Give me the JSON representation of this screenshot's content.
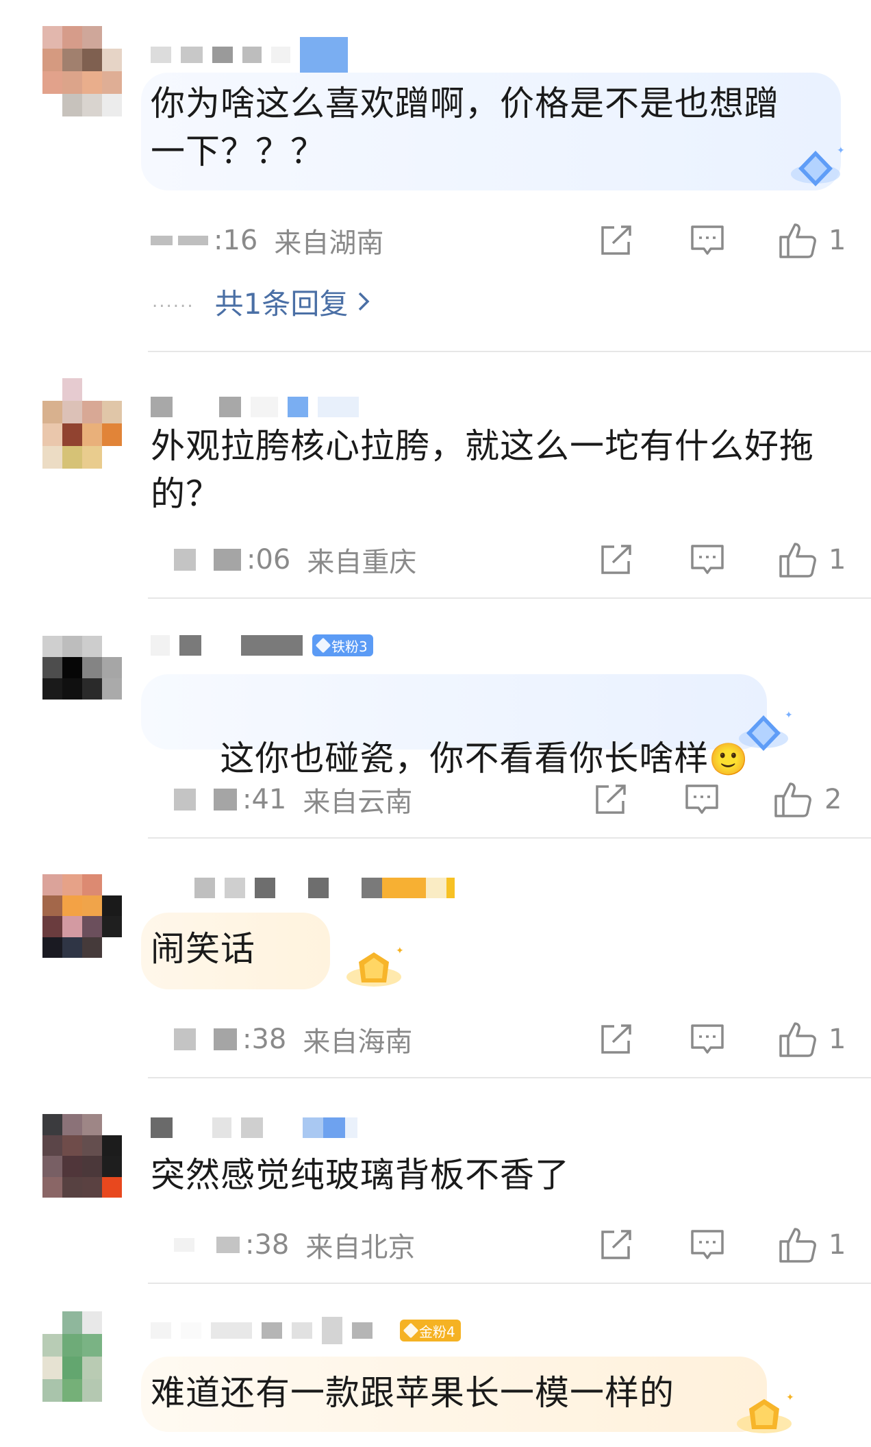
{
  "comments": [
    {
      "text": "你为啥这么喜欢蹭啊，价格是不是也想蹭一下？？？",
      "text_lines": [
        "你为啥这么喜欢蹭啊，价格是不是也想蹭",
        "一下？？？"
      ],
      "time": ":16",
      "location": "来自湖南",
      "likes": "1",
      "replies_link": "共1条回复",
      "badge": "",
      "bubble": "blue"
    },
    {
      "text_lines": [
        "外观拉胯核心拉胯，就这么一坨有什么好拖",
        "的？"
      ],
      "time": ":06",
      "location": "来自重庆",
      "likes": "1",
      "badge": ""
    },
    {
      "text_lines": [
        "这你也碰瓷，你不看看你长啥样"
      ],
      "emoji": "🙂",
      "time": ":41",
      "location": "来自云南",
      "likes": "2",
      "badge": "铁粉3",
      "bubble": "blue"
    },
    {
      "text_lines": [
        "闹笑话"
      ],
      "time": ":38",
      "location": "来自海南",
      "likes": "1",
      "badge": "",
      "bubble": "gold"
    },
    {
      "text_lines": [
        "突然感觉纯玻璃背板不香了"
      ],
      "time": ":38",
      "location": "来自北京",
      "likes": "1",
      "badge": ""
    },
    {
      "text_lines": [
        "难道还有一款跟苹果长一模一样的"
      ],
      "badge": "金粉4",
      "bubble": "gold"
    }
  ],
  "colors": {
    "badge_blue": "#5b9bf5",
    "badge_gold": "#f5b223",
    "link": "#4a6fa5",
    "meta_text": "#8a8a8a",
    "icon": "#8a8a8a"
  },
  "icons": {
    "share": "share-icon",
    "reply": "comment-icon",
    "like": "thumbs-up-icon",
    "chevron": "chevron-right-icon"
  }
}
